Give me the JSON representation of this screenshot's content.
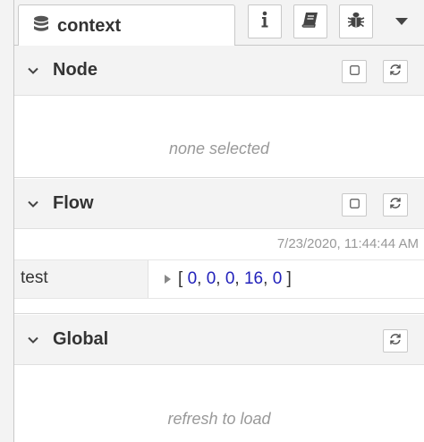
{
  "tabs": {
    "context_label": "context",
    "info_icon": "info-icon",
    "book_icon": "book-icon",
    "bug_icon": "bug-icon"
  },
  "sections": {
    "node": {
      "title": "Node",
      "empty_text": "none selected"
    },
    "flow": {
      "title": "Flow",
      "timestamp": "7/23/2020, 11:44:44 AM",
      "entries": [
        {
          "key": "test",
          "open": "[",
          "values": [
            "0",
            "0",
            "0",
            "16",
            "0"
          ],
          "close": "]"
        }
      ]
    },
    "global": {
      "title": "Global",
      "empty_text": "refresh to load"
    }
  },
  "colors": {
    "number": "#2222bb",
    "muted": "#999999",
    "header_bg": "#f3f3f3",
    "border": "#c8c8c8"
  }
}
